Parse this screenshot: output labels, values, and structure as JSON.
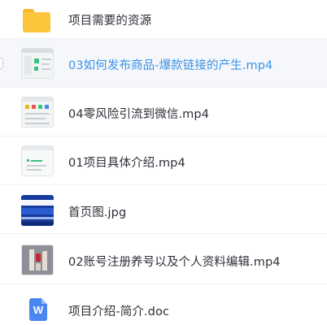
{
  "files": [
    {
      "name": "项目需要的资源",
      "icon": "folder-icon"
    },
    {
      "name": "03如何发布商品-爆款链接的产生.mp4",
      "icon": "video-thumbnail",
      "selected": true
    },
    {
      "name": "04零风险引流到微信.mp4",
      "icon": "video-thumbnail"
    },
    {
      "name": "01项目具体介绍.mp4",
      "icon": "video-thumbnail"
    },
    {
      "name": "首页图.jpg",
      "icon": "image-thumbnail"
    },
    {
      "name": "02账号注册养号以及个人资料编辑.mp4",
      "icon": "video-thumbnail"
    },
    {
      "name": "项目介绍-简介.doc",
      "icon": "word-doc-icon",
      "icon_letter": "W"
    }
  ],
  "colors": {
    "selected_text": "#3b93e6",
    "text": "#2b2f36",
    "folder": "#fcc63c",
    "word": "#4a86f0"
  }
}
